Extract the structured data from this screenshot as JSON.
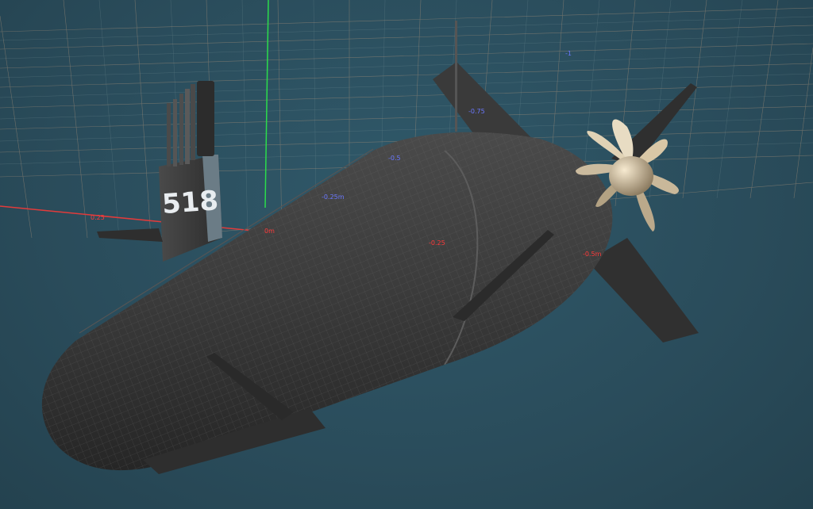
{
  "scene": {
    "background_color": "#2b4e5e",
    "grid_color": "#b9a28b",
    "x_axis_color": "#e23b3b",
    "y_axis_color": "#2bdc4b",
    "hull_color": "#3a3a3a",
    "propeller_color": "#d9c7a6"
  },
  "model": {
    "hull_number": "518"
  },
  "grid_labels": {
    "top_right": "-1",
    "fin_top": "-0.75",
    "deck_mid": "-0.5",
    "deck_front": "-0.25m",
    "red_left": "0.25",
    "red_center": "0m",
    "red_hull": "-0.25",
    "red_stern": "-0.5m"
  }
}
